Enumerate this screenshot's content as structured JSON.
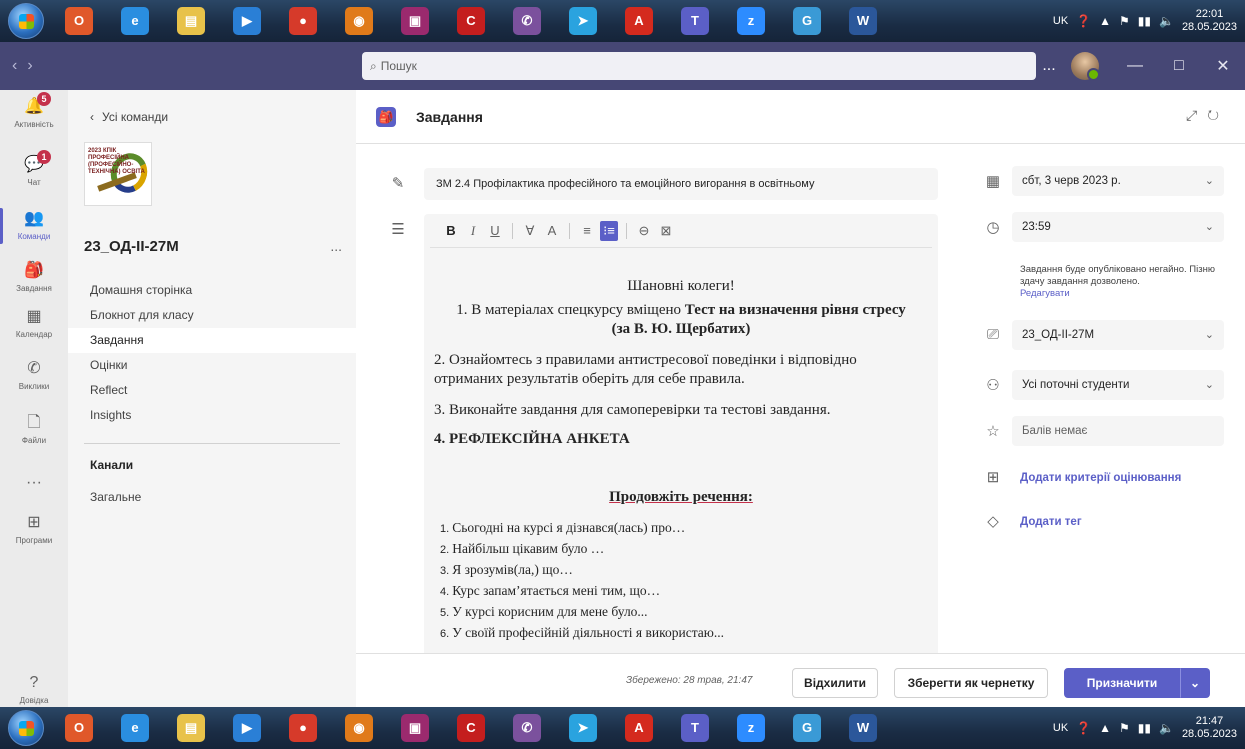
{
  "taskbar_top": {
    "apps": [
      {
        "name": "office-app-icon",
        "color": "#e0582a",
        "glyph": "O"
      },
      {
        "name": "internet-explorer-icon",
        "color": "#2a8ee0",
        "glyph": "e"
      },
      {
        "name": "file-explorer-icon",
        "color": "#e8c24a",
        "glyph": "▤"
      },
      {
        "name": "media-player-icon",
        "color": "#2a7fd6",
        "glyph": "▶"
      },
      {
        "name": "chrome-icon",
        "color": "#d63a2a",
        "glyph": "●"
      },
      {
        "name": "firefox-icon",
        "color": "#e07a1a",
        "glyph": "◉"
      },
      {
        "name": "save-disk-icon",
        "color": "#9b2a6e",
        "glyph": "▣"
      },
      {
        "name": "red-app-icon",
        "color": "#c41e1e",
        "glyph": "C"
      },
      {
        "name": "viber-icon",
        "color": "#7b519d",
        "glyph": "✆"
      },
      {
        "name": "telegram-icon",
        "color": "#2aa3df",
        "glyph": "➤"
      },
      {
        "name": "acrobat-icon",
        "color": "#d42a1e",
        "glyph": "A"
      },
      {
        "name": "teams-icon",
        "color": "#5b5fc7",
        "glyph": "T"
      },
      {
        "name": "zoom-icon",
        "color": "#2d8cff",
        "glyph": "z"
      },
      {
        "name": "color-app-icon",
        "color": "#3a9ad6",
        "glyph": "G"
      },
      {
        "name": "word-icon",
        "color": "#2b579a",
        "glyph": "W"
      }
    ],
    "lang": "UK",
    "time": "22:01",
    "date": "28.05.2023"
  },
  "taskbar_bottom": {
    "lang": "UK",
    "time": "21:47",
    "date": "28.05.2023"
  },
  "titlebar": {
    "search_placeholder": "Пошук",
    "more": "...",
    "minimize": "—",
    "maximize": "□",
    "close": "✕"
  },
  "rail": [
    {
      "label": "Активність",
      "icon": "bell-icon",
      "glyph": "🔔",
      "badge": "5"
    },
    {
      "label": "Чат",
      "icon": "chat-icon",
      "glyph": "💬",
      "badge": "1"
    },
    {
      "label": "Команди",
      "icon": "teams-icon",
      "glyph": "👥",
      "badge": ""
    },
    {
      "label": "Завдання",
      "icon": "assignments-icon",
      "glyph": "🎒",
      "badge": ""
    },
    {
      "label": "Календар",
      "icon": "calendar-icon",
      "glyph": "▦",
      "badge": ""
    },
    {
      "label": "Виклики",
      "icon": "phone-icon",
      "glyph": "✆",
      "badge": ""
    },
    {
      "label": "Файли",
      "icon": "file-icon",
      "glyph": "🗋",
      "badge": ""
    },
    {
      "label": "",
      "icon": "more-icon",
      "glyph": "···",
      "badge": ""
    },
    {
      "label": "Програми",
      "icon": "apps-icon",
      "glyph": "⊞",
      "badge": ""
    },
    {
      "label": "Довідка",
      "icon": "help-icon",
      "glyph": "?",
      "badge": ""
    }
  ],
  "sidebar": {
    "back_label": "Усі команди",
    "team_name": "23_ОД-ІІ-27М",
    "more": "...",
    "logo_text": "2023 КПІК ПРОФЕСІЙНА (ПРОФЕСІЙНО-ТЕХНІЧНА) ОСВІТА",
    "items": [
      "Домашня сторінка",
      "Блокнот для класу",
      "Завдання",
      "Оцінки",
      "Reflect",
      "Insights"
    ],
    "channels_heading": "Канали",
    "channel": "Загальне"
  },
  "header": {
    "title": "Завдання"
  },
  "assignment": {
    "title": "ЗМ 2.4 Профілактика професійного та емоційного вигорання в освітньому",
    "toolbar": [
      "B",
      "I",
      "U",
      "∀",
      "A",
      "≡",
      "⁝≡",
      "⊖",
      "⊠"
    ],
    "doc": {
      "greeting": "Шановні колеги!",
      "p1_prefix": "1. В матеріалах спецкурсу вміщено ",
      "p1_bold": "Тест на визначення рівня стресу (за В. Ю. Щербатих)",
      "p2": "2. Ознайомтесь з правилами антистресової поведінки і відповідно отриманих результатів оберіть для себе правила.",
      "p3": "3. Виконайте завдання для самоперевірки та тестові завдання.",
      "p4": "4. РЕФЛЕКСІЙНА АНКЕТА",
      "continue": "Продовжіть речення:",
      "list": [
        {
          "n": "1.",
          "t": "Сьогодні на курсі я дізнався(лась) про…"
        },
        {
          "n": "2.",
          "t": "Найбільш цікавим було …"
        },
        {
          "n": "3.",
          "t": "Я зрозумів(ла,) що…"
        },
        {
          "n": "4.",
          "t": "Курс запам’ятається мені тим, що…"
        },
        {
          "n": "5.",
          "t": "У курсі корисним для мене було..."
        },
        {
          "n": "6.",
          "t": "У своїй професійній діяльності я використаю..."
        }
      ]
    },
    "due_date": "сбт, 3 черв 2023 р.",
    "due_time": "23:59",
    "publish_note": "Завдання буде опубліковано негайно. Пізню здачу завдання дозволено.",
    "edit_link": "Редагувати",
    "class": "23_ОД-ІІ-27М",
    "students": "Усі поточні студенти",
    "points": "Балів немає",
    "add_rubric": "Додати критерії оцінювання",
    "add_tag": "Додати тег"
  },
  "footer": {
    "saved": "Збережено: 28 трав, 21:47",
    "discard": "Відхилити",
    "save_draft": "Зберегти як чернетку",
    "assign": "Призначити",
    "assign_menu": "⌄"
  },
  "colors": {
    "accent": "#5b5fc7",
    "titlebar": "#464775",
    "badge": "#c4314b"
  }
}
